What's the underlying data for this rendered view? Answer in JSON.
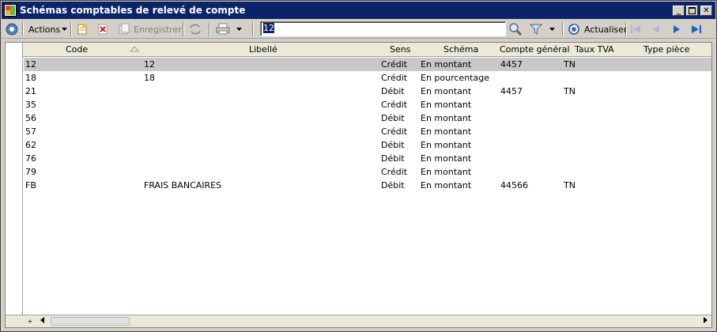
{
  "window": {
    "title": "Schémas comptables de relevé de compte",
    "controls": [
      "minimize",
      "maximize",
      "close"
    ]
  },
  "toolbar": {
    "actions_label": "Actions",
    "save_label": "Enregistrer",
    "search_value": "12",
    "refresh_label": "Actualiser"
  },
  "table": {
    "columns": {
      "code": "Code",
      "libelle": "Libellé",
      "sens": "Sens",
      "schema": "Schéma",
      "compte": "Compte général",
      "tva": "Taux TVA",
      "type_piece": "Type pièce"
    },
    "rows": [
      {
        "code": "12",
        "libelle": "12",
        "sens": "Crédit",
        "schema": "En montant",
        "compte": "4457",
        "tva": "TN",
        "type_piece": ""
      },
      {
        "code": "18",
        "libelle": "18",
        "sens": "Crédit",
        "schema": "En pourcentage",
        "compte": "",
        "tva": "",
        "type_piece": ""
      },
      {
        "code": "21",
        "libelle": "",
        "sens": "Débit",
        "schema": "En montant",
        "compte": "4457",
        "tva": "TN",
        "type_piece": ""
      },
      {
        "code": "35",
        "libelle": "",
        "sens": "Crédit",
        "schema": "En montant",
        "compte": "",
        "tva": "",
        "type_piece": ""
      },
      {
        "code": "56",
        "libelle": "",
        "sens": "Débit",
        "schema": "En montant",
        "compte": "",
        "tva": "",
        "type_piece": ""
      },
      {
        "code": "57",
        "libelle": "",
        "sens": "Crédit",
        "schema": "En montant",
        "compte": "",
        "tva": "",
        "type_piece": ""
      },
      {
        "code": "62",
        "libelle": "",
        "sens": "Débit",
        "schema": "En montant",
        "compte": "",
        "tva": "",
        "type_piece": ""
      },
      {
        "code": "76",
        "libelle": "",
        "sens": "Débit",
        "schema": "En montant",
        "compte": "",
        "tva": "",
        "type_piece": ""
      },
      {
        "code": "79",
        "libelle": "",
        "sens": "Crédit",
        "schema": "En montant",
        "compte": "",
        "tva": "",
        "type_piece": ""
      },
      {
        "code": "FB",
        "libelle": "FRAIS BANCAIRES",
        "sens": "Débit",
        "schema": "En montant",
        "compte": "44566",
        "tva": "TN",
        "type_piece": ""
      }
    ],
    "selected_row": 0
  },
  "colors": {
    "titlebar": "#0a246a",
    "selected_row": "#c8c8c8",
    "window_bg": "#d4d0c8"
  }
}
